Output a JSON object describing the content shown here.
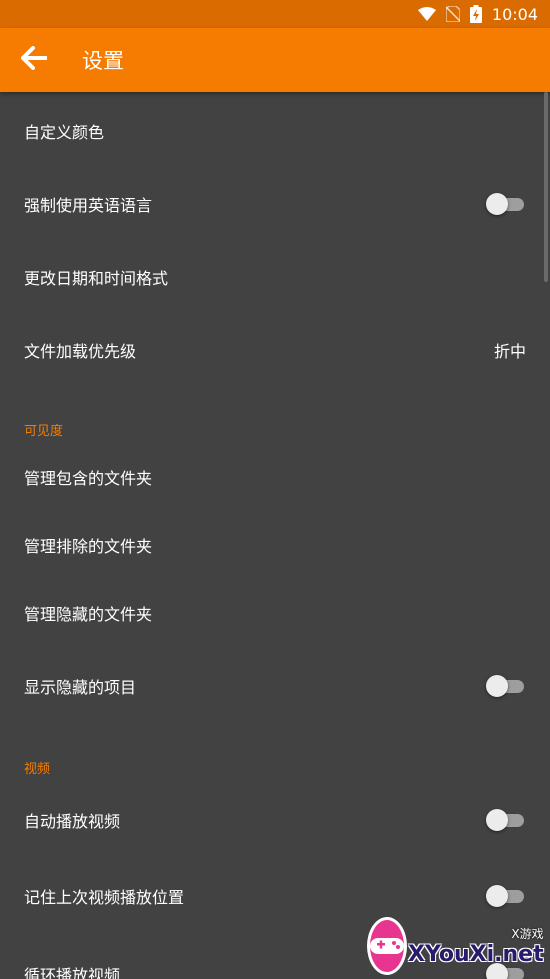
{
  "status_bar": {
    "time": "10:04",
    "icons": [
      "wifi-icon",
      "no-sim-icon",
      "battery-charging-icon"
    ]
  },
  "app_bar": {
    "back_icon": "arrow-back-icon",
    "title": "设置"
  },
  "settings": {
    "custom_colors": {
      "label": "自定义颜色"
    },
    "force_english": {
      "label": "强制使用英语语言",
      "enabled": false
    },
    "date_time_format": {
      "label": "更改日期和时间格式"
    },
    "file_loading_priority": {
      "label": "文件加载优先级",
      "value": "折中"
    },
    "visibility_header": "可见度",
    "manage_included": {
      "label": "管理包含的文件夹"
    },
    "manage_excluded": {
      "label": "管理排除的文件夹"
    },
    "manage_hidden": {
      "label": "管理隐藏的文件夹"
    },
    "show_hidden_items": {
      "label": "显示隐藏的项目",
      "enabled": false
    },
    "video_header": "视频",
    "autoplay_videos": {
      "label": "自动播放视频",
      "enabled": false
    },
    "remember_position": {
      "label": "记住上次视频播放位置",
      "enabled": false
    },
    "loop_videos": {
      "label": "循环播放视频",
      "enabled": false
    }
  },
  "watermark": {
    "tag": "X游戏",
    "site": "XYouXi.net"
  },
  "colors": {
    "status_bar": "#d96b00",
    "app_bar": "#f57c00",
    "background": "#424242",
    "accent": "#f57c00"
  }
}
